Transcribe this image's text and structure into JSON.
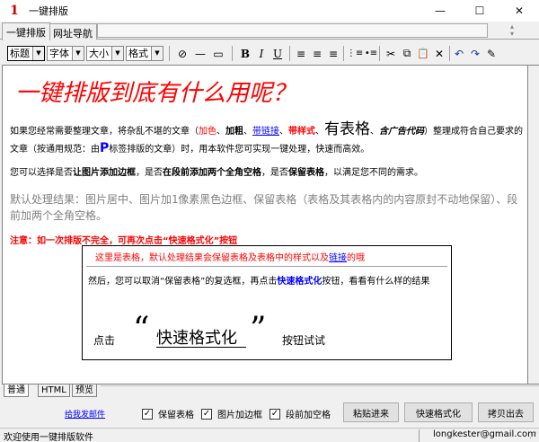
{
  "window": {
    "title": "一键排版",
    "app_icon_glyph": "1",
    "controls": {
      "minimize": "—",
      "maximize": "☐",
      "close": "✕"
    }
  },
  "top_tabs": [
    {
      "label": "一键排版",
      "active": true
    },
    {
      "label": "网址导航",
      "active": false
    }
  ],
  "url_bar": {
    "value": ""
  },
  "toolbar": {
    "selects": [
      {
        "label": "标题"
      },
      {
        "label": "字体"
      },
      {
        "label": "大小"
      },
      {
        "label": "格式"
      }
    ],
    "buttons": {
      "link": "⊘",
      "hr": "—",
      "table": "▭",
      "bold": "B",
      "italic": "I",
      "underline": "U",
      "align_left": "≡",
      "align_center": "≡",
      "align_right": "≡",
      "ol": "⋮≡",
      "ul": "•≡",
      "cut": "✂",
      "copy": "⧉",
      "paste": "📋",
      "delete": "✕",
      "undo": "↶",
      "redo": "↷",
      "edit": "✎"
    }
  },
  "editor": {
    "heading": "一键排版到底有什么用呢？",
    "p1": {
      "a": "如果您经常需要整理文章，将杂乱不堪的文章（",
      "red": "加色",
      "b": "、",
      "bold": "加粗",
      "c": "、",
      "link": "带链接",
      "d": "、",
      "style": "带样式",
      "e": "、",
      "table": "有表格",
      "f": "、",
      "adcode": "含广告代码",
      "g": "）整理成符合自己要求的文章（按通用规范：由",
      "ptag": "P",
      "h": "标签排版的文章）时，用本软件您可实现一键处理，快速而高效。"
    },
    "p2": {
      "a": "您可以选择是否",
      "b1": "让图片添加边框",
      "c": "，是否",
      "b2": "在段前添加两个全角空格",
      "d": "，是否",
      "b3": "保留表格",
      "e": "，以满足您不同的需求。"
    },
    "p3": "默认处理结果：图片居中、图片加1像素黑色边框、保留表格（表格及其表格内的内容原封不动地保留）、段前加两个全角空格。",
    "p4": "注意：如一次排版不完全，可再次点击“快速格式化”按钮",
    "box": {
      "line1_a": "这里是表格，默认处理结果会保留表格及表格中的样式以及",
      "line1_link": "链接",
      "line1_b": "的哦",
      "line2_a": "然后，您可以取消“保留表格”的复选框，再点击",
      "line2_blue": "快速格式化",
      "line2_b": "按钮，看看有什么样的结果",
      "line3_pre": "点击",
      "quote_l": "“",
      "line3_big": "快速格式化",
      "quote_r": "”",
      "line3_post": "按钮试试"
    }
  },
  "bottom_tabs": [
    {
      "label": "普通",
      "active": true
    },
    {
      "label": "HTML",
      "active": false
    },
    {
      "label": "预览",
      "active": false
    }
  ],
  "actionbar": {
    "mail_link": "给我发邮件",
    "checkboxes": [
      {
        "label": "保留表格",
        "checked": true
      },
      {
        "label": "图片加边框",
        "checked": true
      },
      {
        "label": "段前加空格",
        "checked": true
      }
    ],
    "buttons": {
      "paste_in": "粘贴进来",
      "quick_format": "快速格式化",
      "copy_out": "拷贝出去"
    }
  },
  "statusbar": {
    "left": "欢迎使用一键排版软件",
    "right": "longkester@gmail.com"
  }
}
